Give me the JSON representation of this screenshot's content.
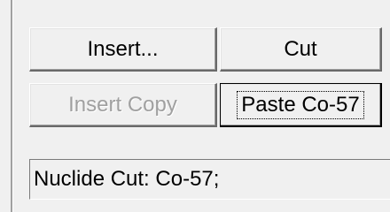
{
  "buttons": {
    "insert": "Insert...",
    "cut": "Cut",
    "insert_copy": "Insert Copy",
    "paste": "Paste Co-57"
  },
  "status": {
    "text": "Nuclide Cut: Co-57;"
  }
}
